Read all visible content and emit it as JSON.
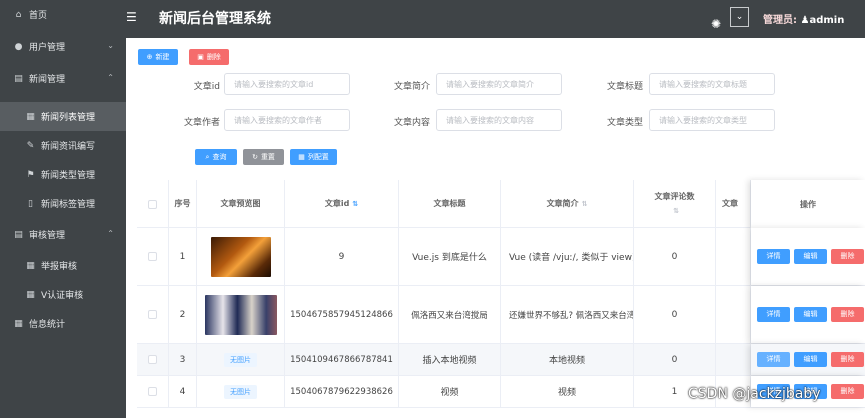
{
  "sidebar": {
    "items": [
      {
        "label": "首页",
        "icon": "home-icon"
      },
      {
        "label": "用户管理",
        "icon": "location-icon"
      },
      {
        "label": "新闻管理",
        "icon": "menu-icon"
      },
      {
        "label": "新闻列表管理",
        "icon": "document-icon"
      },
      {
        "label": "新闻资讯编写",
        "icon": "edit-icon"
      },
      {
        "label": "新闻类型管理",
        "icon": "flag-icon"
      },
      {
        "label": "新闻标签管理",
        "icon": "bookmark-icon"
      },
      {
        "label": "审核管理",
        "icon": "menu-icon"
      },
      {
        "label": "举报审核",
        "icon": "document-icon"
      },
      {
        "label": "V认证审核",
        "icon": "document-icon"
      },
      {
        "label": "信息统计",
        "icon": "document-icon"
      }
    ]
  },
  "header": {
    "title": "新闻后台管理系统",
    "admin_label": "管理员:",
    "admin_name": "admin"
  },
  "toolbar": {
    "new_label": "新建",
    "delete_label": "删除",
    "query_label": "查询",
    "reset_label": "重置",
    "columns_label": "列配置"
  },
  "filters": [
    {
      "label": "文章id",
      "placeholder": "请输入要搜索的文章id"
    },
    {
      "label": "文章简介",
      "placeholder": "请输入要搜索的文章简介"
    },
    {
      "label": "文章标题",
      "placeholder": "请输入要搜索的文章标题"
    },
    {
      "label": "文章作者",
      "placeholder": "请输入要搜索的文章作者"
    },
    {
      "label": "文章内容",
      "placeholder": "请输入要搜索的文章内容"
    },
    {
      "label": "文章类型",
      "placeholder": "请输入要搜索的文章类型"
    }
  ],
  "table": {
    "headers": {
      "index": "序号",
      "preview": "文章预览图",
      "id": "文章id",
      "title": "文章标题",
      "summary": "文章简介",
      "comments_line1": "文章评论数",
      "more": "文章",
      "ops": "操作"
    },
    "no_image": "无图片",
    "actions": {
      "detail": "详情",
      "edit": "编辑",
      "delete": "删除"
    },
    "rows": [
      {
        "index": "1",
        "id": "9",
        "title": "Vue.js 到底是什么",
        "summary": "Vue (读音 /vjuː/, 类似于 view) 是...",
        "comments": "0",
        "image": "thumb1"
      },
      {
        "index": "2",
        "id": "1504675857945124866",
        "title": "佩洛西又来台湾搅局",
        "summary": "还嫌世界不够乱? 佩洛西又来台湾...",
        "comments": "0",
        "image": "thumb2"
      },
      {
        "index": "3",
        "id": "1504109467866787841",
        "title": "插入本地视频",
        "summary": "本地视频",
        "comments": "0",
        "image": ""
      },
      {
        "index": "4",
        "id": "1504067879622938626",
        "title": "视频",
        "summary": "视频",
        "comments": "1",
        "image": ""
      }
    ]
  },
  "watermark": "CSDN @jackzjbaby"
}
